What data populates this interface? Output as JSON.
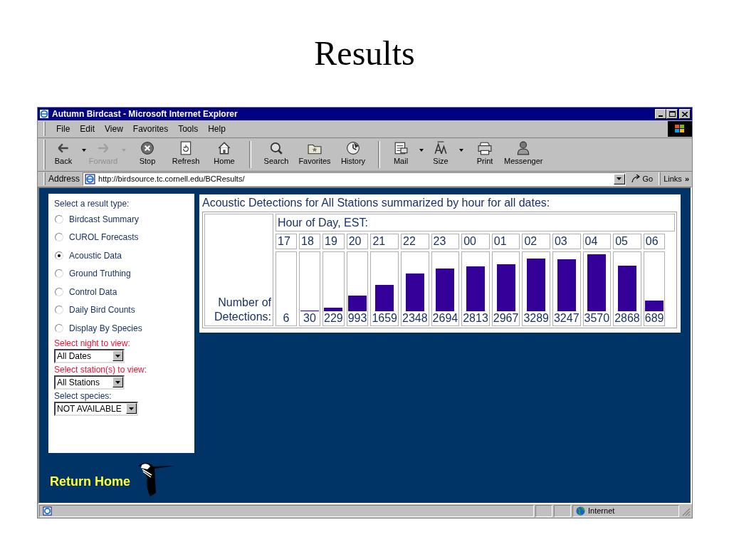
{
  "slide_title": "Results",
  "window": {
    "title": "Autumn Birdcast - Microsoft Internet Explorer"
  },
  "menu": [
    "File",
    "Edit",
    "View",
    "Favorites",
    "Tools",
    "Help"
  ],
  "toolbar": [
    [
      {
        "kind": "back",
        "label": "Back",
        "disabled": false,
        "has_menu": true
      },
      {
        "kind": "forward",
        "label": "Forward",
        "disabled": true,
        "has_menu": true
      },
      {
        "kind": "stop",
        "label": "Stop",
        "disabled": false,
        "has_menu": false
      },
      {
        "kind": "refresh",
        "label": "Refresh",
        "disabled": false,
        "has_menu": false
      },
      {
        "kind": "home",
        "label": "Home",
        "disabled": false,
        "has_menu": false
      }
    ],
    [
      {
        "kind": "search",
        "label": "Search",
        "disabled": false,
        "has_menu": false
      },
      {
        "kind": "favorites",
        "label": "Favorites",
        "disabled": false,
        "has_menu": false
      },
      {
        "kind": "history",
        "label": "History",
        "disabled": false,
        "has_menu": false
      }
    ],
    [
      {
        "kind": "mail",
        "label": "Mail",
        "disabled": false,
        "has_menu": true
      },
      {
        "kind": "size",
        "label": "Size",
        "disabled": false,
        "has_menu": true
      },
      {
        "kind": "print",
        "label": "Print",
        "disabled": false,
        "has_menu": false
      },
      {
        "kind": "messenger",
        "label": "Messenger",
        "disabled": false,
        "has_menu": false
      }
    ]
  ],
  "address_bar": {
    "label": "Address",
    "value": "http://birdsource.tc.cornell.edu/BCResults/",
    "go": "Go",
    "links": "Links",
    "links_more": "»"
  },
  "sidebar": {
    "heading": "Select a result type:",
    "options": [
      {
        "label": "Birdcast Summary",
        "selected": false
      },
      {
        "label": "CUROL Forecasts",
        "selected": false
      },
      {
        "label": "Acoustic Data",
        "selected": true
      },
      {
        "label": "Ground Truthing",
        "selected": false
      },
      {
        "label": "Control Data",
        "selected": false
      },
      {
        "label": "Daily Bird Counts",
        "selected": false
      },
      {
        "label": "Display By Species",
        "selected": false
      }
    ],
    "selects": [
      {
        "label": "Select night to view:",
        "color": "#ee1133",
        "value": "All Dates"
      },
      {
        "label": "Select station(s) to view:",
        "color": "#ee1133",
        "value": "All Stations"
      },
      {
        "label": "Select species:",
        "color": "#1a3366",
        "value": "NOT AVAILABLE"
      }
    ]
  },
  "return_home": "Return Home",
  "detections": {
    "title": "Acoustic Detections for All Stations summarized by hour for all dates:",
    "header": "Hour of Day, EST:",
    "row_label": "Number of Detections:",
    "columns": [
      {
        "hour": "17",
        "count": "6"
      },
      {
        "hour": "18",
        "count": "30"
      },
      {
        "hour": "19",
        "count": "229"
      },
      {
        "hour": "20",
        "count": "993"
      },
      {
        "hour": "21",
        "count": "1659"
      },
      {
        "hour": "22",
        "count": "2348"
      },
      {
        "hour": "23",
        "count": "2694"
      },
      {
        "hour": "00",
        "count": "2813"
      },
      {
        "hour": "01",
        "count": "2967"
      },
      {
        "hour": "02",
        "count": "3289"
      },
      {
        "hour": "03",
        "count": "3247"
      },
      {
        "hour": "04",
        "count": "3570"
      },
      {
        "hour": "05",
        "count": "2868"
      },
      {
        "hour": "06",
        "count": "689"
      }
    ]
  },
  "status_bar": {
    "zone": "Internet"
  }
}
